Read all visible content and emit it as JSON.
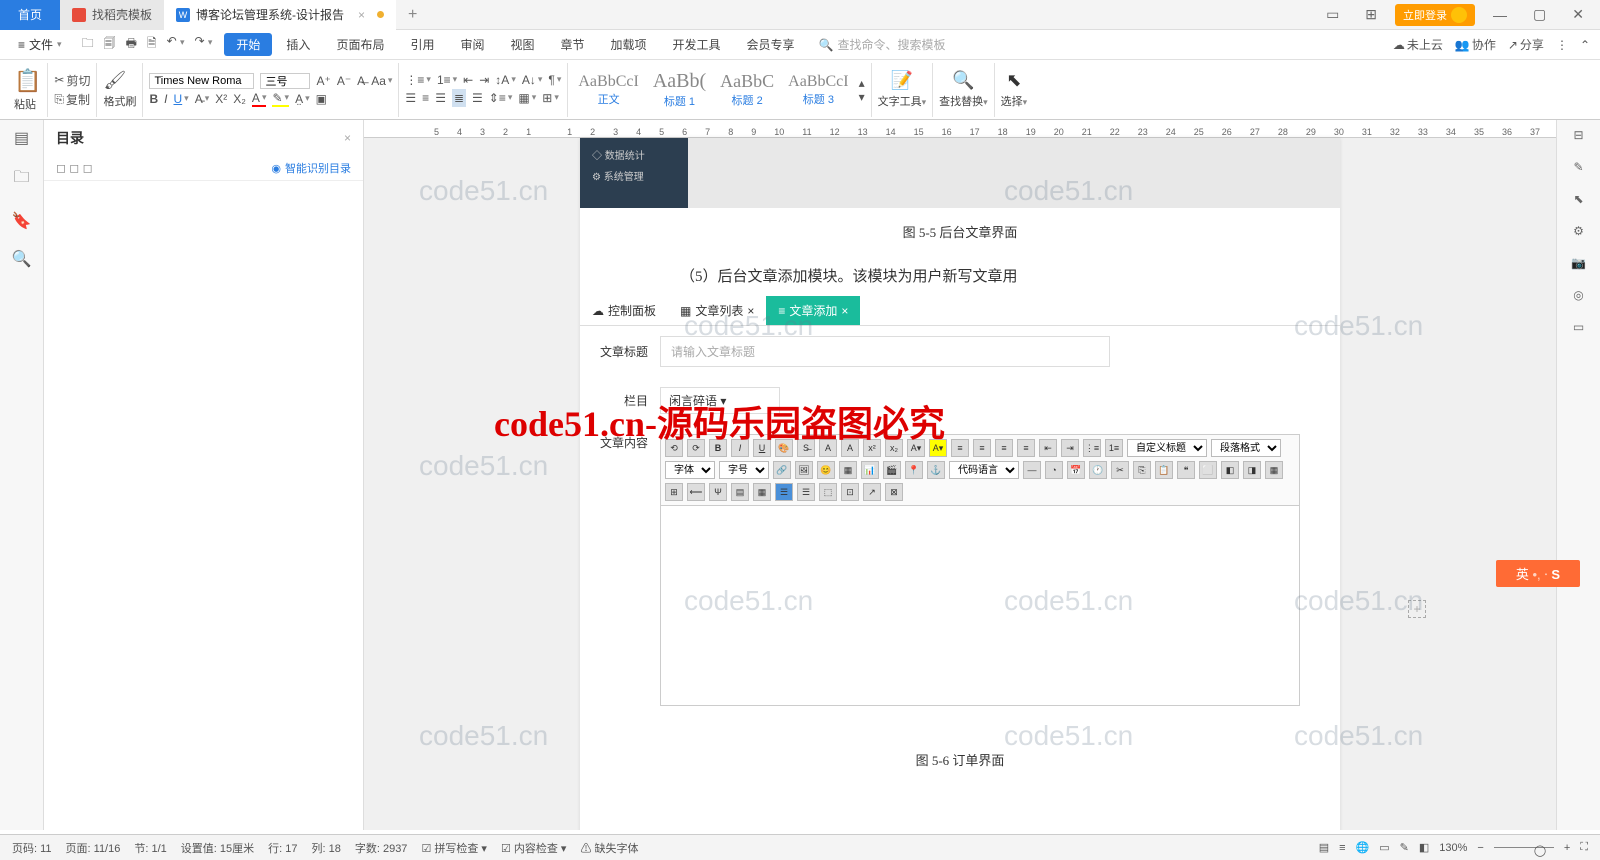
{
  "titlebar": {
    "home": "首页",
    "template_tab": "找稻壳模板",
    "doc_tab": "博客论坛管理系统-设计报告",
    "login": "立即登录"
  },
  "menubar": {
    "file": "文件",
    "start": "开始",
    "insert": "插入",
    "page_layout": "页面布局",
    "reference": "引用",
    "review": "审阅",
    "view": "视图",
    "chapter": "章节",
    "addon": "加载项",
    "dev": "开发工具",
    "member": "会员专享",
    "search_ph": "查找命令、搜索模板",
    "not_cloud": "未上云",
    "collab": "协作",
    "share": "分享"
  },
  "toolbar": {
    "paste": "粘贴",
    "cut": "剪切",
    "copy": "复制",
    "format": "格式刷",
    "font_name": "Times New Roma",
    "font_size": "三号",
    "styles": [
      {
        "preview": "AaBbCcI",
        "label": "正文"
      },
      {
        "preview": "AaBb(",
        "label": "标题 1"
      },
      {
        "preview": "AaBbC",
        "label": "标题 2"
      },
      {
        "preview": "AaBbCcI",
        "label": "标题 3"
      }
    ],
    "text_tool": "文字工具",
    "find": "查找替换",
    "select": "选择"
  },
  "toc": {
    "title": "目录",
    "smart": "智能识别目录"
  },
  "doc": {
    "sidebar_item1": "数据统计",
    "sidebar_item2": "系统管理",
    "caption1": "图 5-5   后台文章界面",
    "para1": "（5）后台文章添加模块。该模块为用户新写文章用",
    "tab_dashboard": "控制面板",
    "tab_list": "文章列表",
    "tab_add": "文章添加",
    "form_title_label": "文章标题",
    "form_title_ph": "请输入文章标题",
    "form_col_label": "栏目",
    "form_col_val": "闲言碎语",
    "form_content_label": "文章内容",
    "ed_custom": "自定义标题",
    "ed_para": "段落格式",
    "ed_font": "字体",
    "ed_size": "字号",
    "ed_code": "代码语言",
    "caption2": "图 5-6   订单界面"
  },
  "watermarks": {
    "wm": "code51.cn",
    "wm_red": "code51.cn-源码乐园盗图必究"
  },
  "ime": {
    "text": "英"
  },
  "statusbar": {
    "page_no": "页码: 11",
    "page": "页面: 11/16",
    "section": "节: 1/1",
    "pos": "设置值: 15厘米",
    "row": "行: 17",
    "col": "列: 18",
    "words": "字数: 2937",
    "spell": "拼写检查",
    "content_check": "内容检查",
    "missing_font": "缺失字体",
    "zoom": "130%"
  }
}
